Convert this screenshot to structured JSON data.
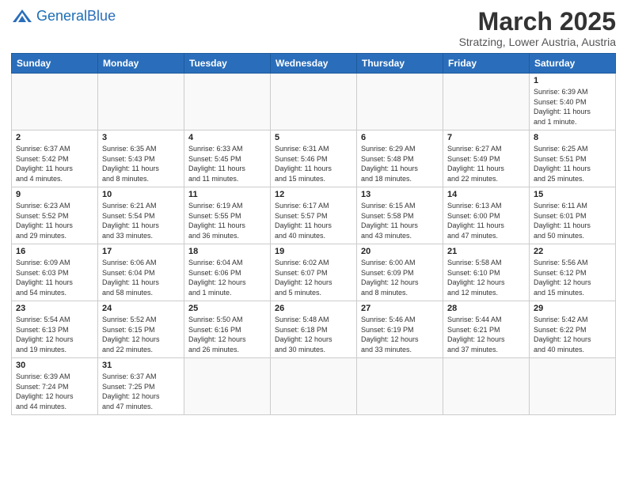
{
  "header": {
    "logo_general": "General",
    "logo_blue": "Blue",
    "title": "March 2025",
    "subtitle": "Stratzing, Lower Austria, Austria"
  },
  "days_of_week": [
    "Sunday",
    "Monday",
    "Tuesday",
    "Wednesday",
    "Thursday",
    "Friday",
    "Saturday"
  ],
  "weeks": [
    [
      {
        "day": "",
        "info": ""
      },
      {
        "day": "",
        "info": ""
      },
      {
        "day": "",
        "info": ""
      },
      {
        "day": "",
        "info": ""
      },
      {
        "day": "",
        "info": ""
      },
      {
        "day": "",
        "info": ""
      },
      {
        "day": "1",
        "info": "Sunrise: 6:39 AM\nSunset: 5:40 PM\nDaylight: 11 hours\nand 1 minute."
      }
    ],
    [
      {
        "day": "2",
        "info": "Sunrise: 6:37 AM\nSunset: 5:42 PM\nDaylight: 11 hours\nand 4 minutes."
      },
      {
        "day": "3",
        "info": "Sunrise: 6:35 AM\nSunset: 5:43 PM\nDaylight: 11 hours\nand 8 minutes."
      },
      {
        "day": "4",
        "info": "Sunrise: 6:33 AM\nSunset: 5:45 PM\nDaylight: 11 hours\nand 11 minutes."
      },
      {
        "day": "5",
        "info": "Sunrise: 6:31 AM\nSunset: 5:46 PM\nDaylight: 11 hours\nand 15 minutes."
      },
      {
        "day": "6",
        "info": "Sunrise: 6:29 AM\nSunset: 5:48 PM\nDaylight: 11 hours\nand 18 minutes."
      },
      {
        "day": "7",
        "info": "Sunrise: 6:27 AM\nSunset: 5:49 PM\nDaylight: 11 hours\nand 22 minutes."
      },
      {
        "day": "8",
        "info": "Sunrise: 6:25 AM\nSunset: 5:51 PM\nDaylight: 11 hours\nand 25 minutes."
      }
    ],
    [
      {
        "day": "9",
        "info": "Sunrise: 6:23 AM\nSunset: 5:52 PM\nDaylight: 11 hours\nand 29 minutes."
      },
      {
        "day": "10",
        "info": "Sunrise: 6:21 AM\nSunset: 5:54 PM\nDaylight: 11 hours\nand 33 minutes."
      },
      {
        "day": "11",
        "info": "Sunrise: 6:19 AM\nSunset: 5:55 PM\nDaylight: 11 hours\nand 36 minutes."
      },
      {
        "day": "12",
        "info": "Sunrise: 6:17 AM\nSunset: 5:57 PM\nDaylight: 11 hours\nand 40 minutes."
      },
      {
        "day": "13",
        "info": "Sunrise: 6:15 AM\nSunset: 5:58 PM\nDaylight: 11 hours\nand 43 minutes."
      },
      {
        "day": "14",
        "info": "Sunrise: 6:13 AM\nSunset: 6:00 PM\nDaylight: 11 hours\nand 47 minutes."
      },
      {
        "day": "15",
        "info": "Sunrise: 6:11 AM\nSunset: 6:01 PM\nDaylight: 11 hours\nand 50 minutes."
      }
    ],
    [
      {
        "day": "16",
        "info": "Sunrise: 6:09 AM\nSunset: 6:03 PM\nDaylight: 11 hours\nand 54 minutes."
      },
      {
        "day": "17",
        "info": "Sunrise: 6:06 AM\nSunset: 6:04 PM\nDaylight: 11 hours\nand 58 minutes."
      },
      {
        "day": "18",
        "info": "Sunrise: 6:04 AM\nSunset: 6:06 PM\nDaylight: 12 hours\nand 1 minute."
      },
      {
        "day": "19",
        "info": "Sunrise: 6:02 AM\nSunset: 6:07 PM\nDaylight: 12 hours\nand 5 minutes."
      },
      {
        "day": "20",
        "info": "Sunrise: 6:00 AM\nSunset: 6:09 PM\nDaylight: 12 hours\nand 8 minutes."
      },
      {
        "day": "21",
        "info": "Sunrise: 5:58 AM\nSunset: 6:10 PM\nDaylight: 12 hours\nand 12 minutes."
      },
      {
        "day": "22",
        "info": "Sunrise: 5:56 AM\nSunset: 6:12 PM\nDaylight: 12 hours\nand 15 minutes."
      }
    ],
    [
      {
        "day": "23",
        "info": "Sunrise: 5:54 AM\nSunset: 6:13 PM\nDaylight: 12 hours\nand 19 minutes."
      },
      {
        "day": "24",
        "info": "Sunrise: 5:52 AM\nSunset: 6:15 PM\nDaylight: 12 hours\nand 22 minutes."
      },
      {
        "day": "25",
        "info": "Sunrise: 5:50 AM\nSunset: 6:16 PM\nDaylight: 12 hours\nand 26 minutes."
      },
      {
        "day": "26",
        "info": "Sunrise: 5:48 AM\nSunset: 6:18 PM\nDaylight: 12 hours\nand 30 minutes."
      },
      {
        "day": "27",
        "info": "Sunrise: 5:46 AM\nSunset: 6:19 PM\nDaylight: 12 hours\nand 33 minutes."
      },
      {
        "day": "28",
        "info": "Sunrise: 5:44 AM\nSunset: 6:21 PM\nDaylight: 12 hours\nand 37 minutes."
      },
      {
        "day": "29",
        "info": "Sunrise: 5:42 AM\nSunset: 6:22 PM\nDaylight: 12 hours\nand 40 minutes."
      }
    ],
    [
      {
        "day": "30",
        "info": "Sunrise: 6:39 AM\nSunset: 7:24 PM\nDaylight: 12 hours\nand 44 minutes."
      },
      {
        "day": "31",
        "info": "Sunrise: 6:37 AM\nSunset: 7:25 PM\nDaylight: 12 hours\nand 47 minutes."
      },
      {
        "day": "",
        "info": ""
      },
      {
        "day": "",
        "info": ""
      },
      {
        "day": "",
        "info": ""
      },
      {
        "day": "",
        "info": ""
      },
      {
        "day": "",
        "info": ""
      }
    ]
  ]
}
